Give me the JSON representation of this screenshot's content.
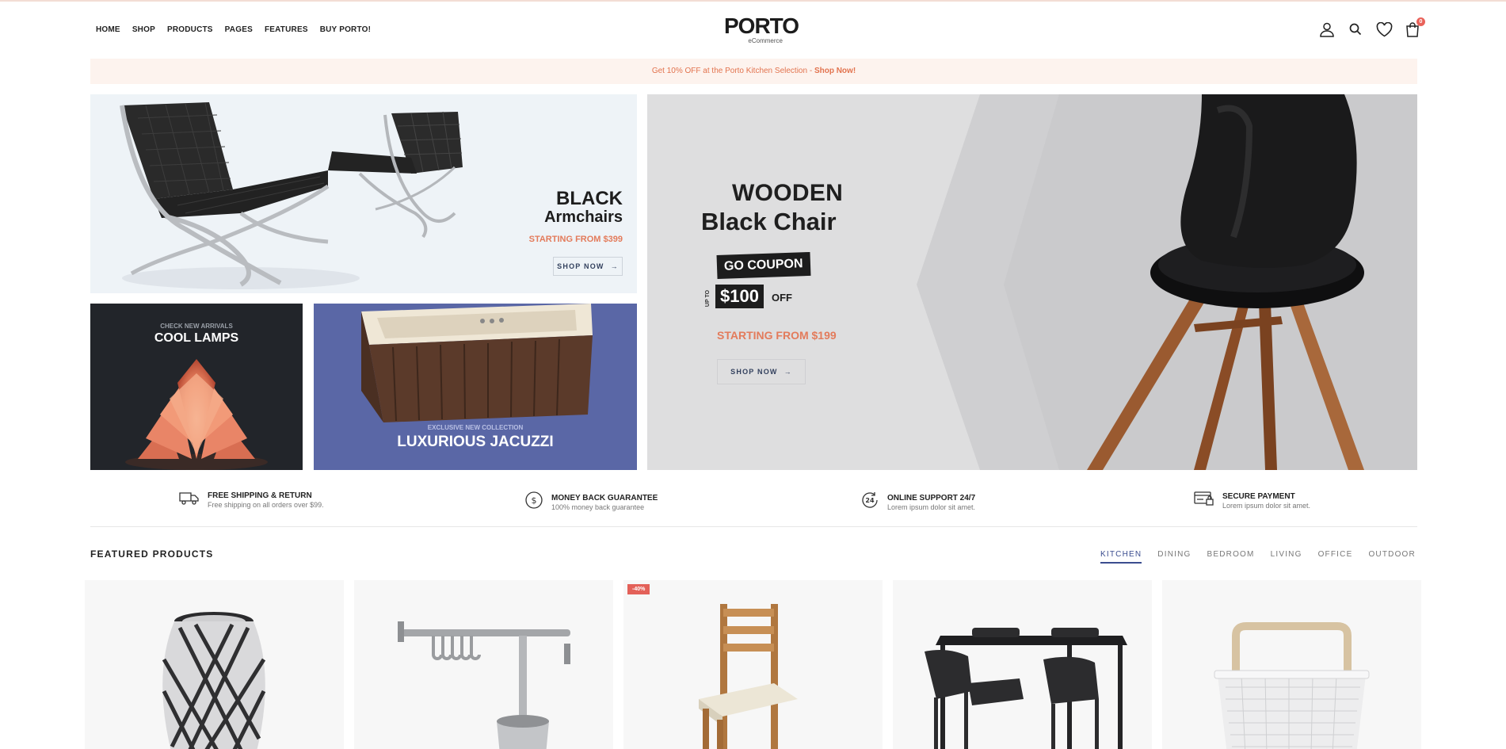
{
  "header": {
    "nav": [
      "HOME",
      "SHOP",
      "PRODUCTS",
      "PAGES",
      "FEATURES",
      "BUY PORTO!"
    ],
    "logo": {
      "brand": "PORTO",
      "sub": "eCommerce"
    },
    "icons": [
      "user-icon",
      "search-icon",
      "heart-icon",
      "cart-icon"
    ],
    "cart_count": "0"
  },
  "promo": {
    "text": "Get 10% OFF at the Porto Kitchen Selection - ",
    "link": "Shop Now!"
  },
  "banners": {
    "armchairs": {
      "line1": "BLACK",
      "line2": "Armchairs",
      "price": "STARTING FROM $399",
      "button": "SHOP NOW"
    },
    "lamps": {
      "small": "CHECK NEW ARRIVALS",
      "large": "COOL LAMPS"
    },
    "jacuzzi": {
      "small": "EXCLUSIVE NEW COLLECTION",
      "large": "LUXURIOUS JACUZZI"
    },
    "chair": {
      "line1": "WOODEN",
      "line2": "Black Chair",
      "coupon": "GO COUPON",
      "upto": "UP TO",
      "amount": "$100",
      "off": "OFF",
      "price": "STARTING FROM $199",
      "button": "SHOP NOW"
    }
  },
  "services": [
    {
      "title": "FREE SHIPPING & RETURN",
      "desc": "Free shipping on all orders over $99.",
      "icon": "truck-icon"
    },
    {
      "title": "MONEY BACK GUARANTEE",
      "desc": "100% money back guarantee",
      "icon": "dollar-icon"
    },
    {
      "title": "ONLINE SUPPORT 24/7",
      "desc": "Lorem ipsum dolor sit amet.",
      "icon": "support-24-icon"
    },
    {
      "title": "SECURE PAYMENT",
      "desc": "Lorem ipsum dolor sit amet.",
      "icon": "secure-card-icon"
    }
  ],
  "featured": {
    "title": "FEATURED PRODUCTS",
    "tabs": [
      "KITCHEN",
      "DINING",
      "BEDROOM",
      "LIVING",
      "OFFICE",
      "OUTDOOR"
    ],
    "active_tab": "KITCHEN",
    "sale_badge": "-40%"
  },
  "colors": {
    "accent": "#e37b5b",
    "primary": "#3b4d8f",
    "badge": "#e36159"
  }
}
